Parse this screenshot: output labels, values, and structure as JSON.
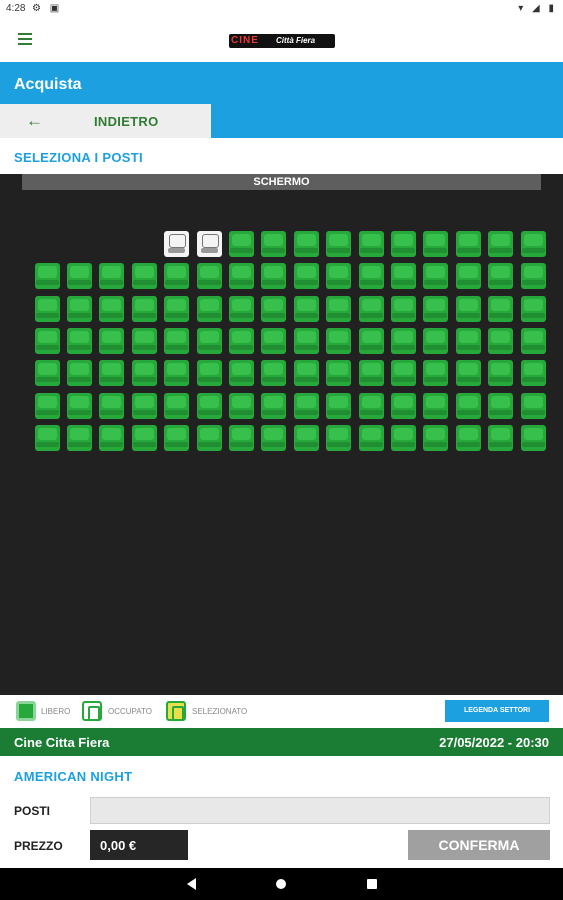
{
  "status_bar": {
    "time": "4:28",
    "icons": "⚙ ▣",
    "right_icons": "▾ ◢ ▮"
  },
  "header": {
    "logo_main": "CINE",
    "logo_sub": "Città Fiera"
  },
  "page": {
    "title": "Acquista",
    "back_label": "INDIETRO",
    "back_arrow": "←",
    "section_title": "SELEZIONA I POSTI"
  },
  "seatmap": {
    "screen_label": "SCHERMO",
    "rows": [
      {
        "seats": [
          "occupied",
          "occupied",
          "free",
          "free",
          "free",
          "free",
          "free",
          "free",
          "free",
          "free",
          "free",
          "free"
        ]
      },
      {
        "seats": [
          "free",
          "free",
          "free",
          "free",
          "free",
          "free",
          "free",
          "free",
          "free",
          "free",
          "free",
          "free",
          "free",
          "free",
          "free",
          "free"
        ]
      },
      {
        "seats": [
          "free",
          "free",
          "free",
          "free",
          "free",
          "free",
          "free",
          "free",
          "free",
          "free",
          "free",
          "free",
          "free",
          "free",
          "free",
          "free"
        ]
      },
      {
        "seats": [
          "free",
          "free",
          "free",
          "free",
          "free",
          "free",
          "free",
          "free",
          "free",
          "free",
          "free",
          "free",
          "free",
          "free",
          "free",
          "free"
        ]
      },
      {
        "seats": [
          "free",
          "free",
          "free",
          "free",
          "free",
          "free",
          "free",
          "free",
          "free",
          "free",
          "free",
          "free",
          "free",
          "free",
          "free",
          "free"
        ]
      },
      {
        "seats": [
          "free",
          "free",
          "free",
          "free",
          "free",
          "free",
          "free",
          "free",
          "free",
          "free",
          "free",
          "free",
          "free",
          "free",
          "free",
          "free"
        ]
      },
      {
        "seats": [
          "free",
          "free",
          "free",
          "free",
          "free",
          "free",
          "free",
          "free",
          "free",
          "free",
          "free",
          "free",
          "free",
          "free",
          "free",
          "free"
        ]
      }
    ],
    "colors": {
      "free": "#26a83b",
      "occupied": "#f4f4f4",
      "background": "#212121"
    }
  },
  "legend": {
    "free": "LIBERO",
    "occupied": "OCCUPATO",
    "selected": "SELEZIONATO",
    "sectors_button": "LEGENDA SETTORI"
  },
  "info": {
    "cinema": "Cine Citta Fiera",
    "datetime": "27/05/2022 - 20:30",
    "movie": "AMERICAN NIGHT"
  },
  "form": {
    "posti_label": "POSTI",
    "posti_value": "",
    "prezzo_label": "PREZZO",
    "prezzo_value": "0,00 €",
    "confirm_label": "CONFERMA"
  },
  "theme": {
    "accent": "#1ca0e0",
    "green": "#1b7d34"
  }
}
